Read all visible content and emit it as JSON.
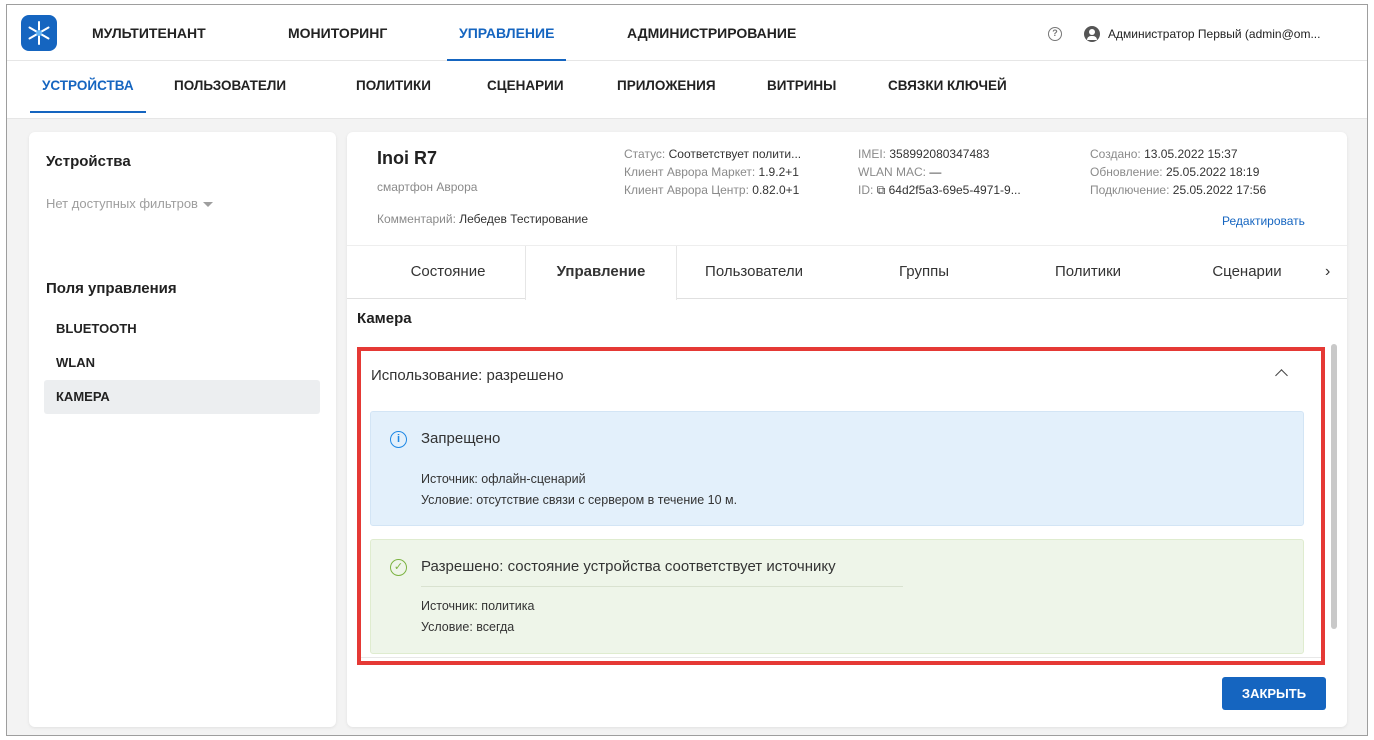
{
  "top_nav": {
    "items": [
      "МУЛЬТИТЕНАНТ",
      "МОНИТОРИНГ",
      "УПРАВЛЕНИЕ",
      "АДМИНИСТРИРОВАНИЕ"
    ],
    "active_index": 2,
    "help_icon": "question-circle-icon",
    "user_icon": "account-circle-icon",
    "user_label": "Администратор Первый (admin@om..."
  },
  "sub_nav": {
    "items": [
      "УСТРОЙСТВА",
      "ПОЛЬЗОВАТЕЛИ",
      "ПОЛИТИКИ",
      "СЦЕНАРИИ",
      "ПРИЛОЖЕНИЯ",
      "ВИТРИНЫ",
      "СВЯЗКИ КЛЮЧЕЙ"
    ],
    "active_index": 0
  },
  "left_panel": {
    "title": "Устройства",
    "filter_label": "Нет доступных фильтров",
    "fields_title": "Поля управления",
    "fields": [
      "BLUETOOTH",
      "WLAN",
      "КАМЕРА"
    ],
    "active_field": 2
  },
  "device": {
    "name": "Inoi R7",
    "type": "смартфон Аврора",
    "comment_label": "Комментарий:",
    "comment_value": "Лебедев Тестирование",
    "status_label": "Статус:",
    "status_value": "Соответствует полити...",
    "market_label": "Клиент Аврора Маркет:",
    "market_value": "1.9.2+1",
    "center_label": "Клиент Аврора Центр:",
    "center_value": "0.82.0+1",
    "imei_label": "IMEI:",
    "imei_value": "358992080347483",
    "wlan_label": "WLAN MAC:",
    "wlan_value": "—",
    "id_label": "ID:",
    "id_value": "64d2f5a3-69e5-4971-9...",
    "created_label": "Создано:",
    "created_value": "13.05.2022 15:37",
    "updated_label": "Обновление:",
    "updated_value": "25.05.2022 18:19",
    "connected_label": "Подключение:",
    "connected_value": "25.05.2022 17:56",
    "edit_label": "Редактировать"
  },
  "tabs": {
    "items": [
      "Состояние",
      "Управление",
      "Пользователи",
      "Группы",
      "Политики",
      "Сценарии"
    ],
    "active_index": 1,
    "next_icon": "chevron-right-icon"
  },
  "section": {
    "title": "Камера",
    "accordion_title": "Использование: разрешено",
    "info_card": {
      "icon": "info-icon",
      "title": "Запрещено",
      "source": "Источник: офлайн-сценарий",
      "condition": "Условие: отсутствие связи с сервером в течение 10 м."
    },
    "ok_card": {
      "icon": "check-circle-icon",
      "title": "Разрешено: состояние устройства соответствует источнику",
      "source": "Источник: политика",
      "condition": "Условие: всегда"
    }
  },
  "close_button": "ЗАКРЫТЬ",
  "colors": {
    "accent": "#1565c0",
    "highlight": "#e53935",
    "info_bg": "#e3f0fb",
    "ok_bg": "#eef5e9"
  }
}
